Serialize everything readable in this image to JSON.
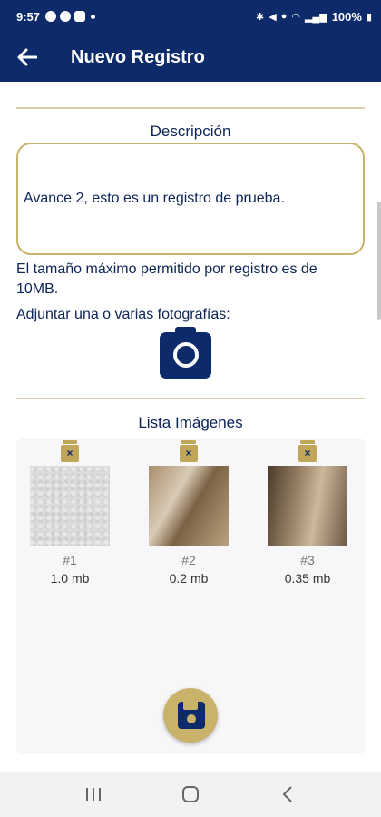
{
  "status_bar": {
    "time": "9:57",
    "battery": "100%"
  },
  "app_bar": {
    "title": "Nuevo Registro",
    "back_icon": "arrow-left-icon"
  },
  "description": {
    "label": "Descripción",
    "value": "Avance 2, esto es un registro de prueba."
  },
  "info": {
    "max_size": "El tamaño máximo permitido por registro es de 10MB.",
    "attach_prompt": "Adjuntar una o varias fotografías:"
  },
  "image_list": {
    "label": "Lista Imágenes",
    "images": [
      {
        "number": "#1",
        "size": "1.0 mb"
      },
      {
        "number": "#2",
        "size": "0.2 mb"
      },
      {
        "number": "#3",
        "size": "0.35 mb"
      }
    ]
  },
  "colors": {
    "primary": "#0d2a6b",
    "accent": "#c9b26a",
    "divider": "#d9cfa6"
  },
  "icons": {
    "camera": "camera-icon",
    "delete": "trash-icon",
    "save": "floppy-disk-icon",
    "nav_recents": "recents-icon",
    "nav_home": "home-icon",
    "nav_back": "back-chevron-icon"
  }
}
